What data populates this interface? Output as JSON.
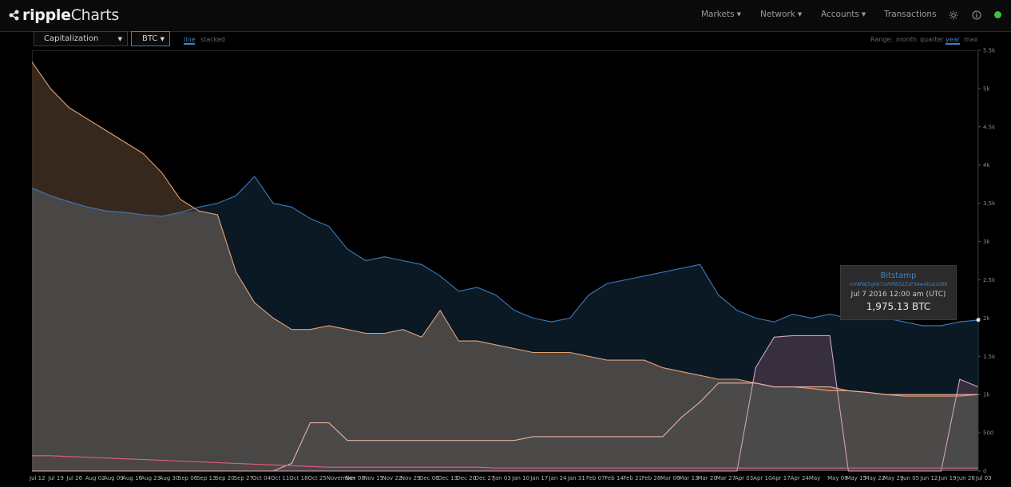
{
  "header": {
    "logo_word1": "ripple",
    "logo_word2": "Charts",
    "nav": [
      {
        "label": "Markets",
        "caret": true
      },
      {
        "label": "Network",
        "caret": true
      },
      {
        "label": "Accounts",
        "caret": true
      },
      {
        "label": "Transactions",
        "caret": false
      }
    ],
    "icons": [
      "settings-icon",
      "info-icon",
      "status-indicator"
    ],
    "status_color": "#3fbf3f"
  },
  "controls": {
    "metric": "Capitalization",
    "currency": "BTC",
    "modes": [
      "line",
      "stacked"
    ],
    "active_mode": "line",
    "range_label": "Range:",
    "ranges": [
      "month",
      "quarter",
      "year",
      "max"
    ],
    "active_range": "year"
  },
  "tooltip": {
    "name": "Bitstamp",
    "address": "rvYAfWj5gh67oV6fW32ZzP3Aw4Eubs59B",
    "date": "Jul 7 2016 12:00 am (UTC)",
    "value": "1,975.13 BTC"
  },
  "chart_data": {
    "type": "area",
    "title": "",
    "xlabel": "",
    "ylabel": "",
    "ylim": [
      0,
      5500
    ],
    "y_ticks": [
      "0",
      "500",
      "1k",
      "1.5k",
      "2k",
      "2.5k",
      "3k",
      "3.5k",
      "4k",
      "4.5k",
      "5k",
      "5.5k"
    ],
    "grid": false,
    "categories": [
      "Jul 12",
      "Jul 19",
      "Jul 26",
      "Aug 02",
      "Aug 09",
      "Aug 16",
      "Aug 23",
      "Aug 30",
      "Sep 06",
      "Sep 13",
      "Sep 20",
      "Sep 27",
      "Oct 04",
      "Oct 11",
      "Oct 18",
      "Oct 25",
      "November",
      "Nov 08",
      "Nov 15",
      "Nov 22",
      "Nov 29",
      "Dec 06",
      "Dec 13",
      "Dec 20",
      "Dec 27",
      "Jan 03",
      "Jan 10",
      "Jan 17",
      "Jan 24",
      "Jan 31",
      "Feb 07",
      "Feb 14",
      "Feb 21",
      "Feb 28",
      "Mar 06",
      "Mar 13",
      "Mar 20",
      "Mar 27",
      "Apr 03",
      "Apr 10",
      "Apr 17",
      "Apr 24",
      "May",
      "May 08",
      "May 15",
      "May 22",
      "May 29",
      "Jun 05",
      "Jun 12",
      "Jun 19",
      "Jun 26",
      "Jul 03"
    ],
    "series": [
      {
        "name": "Bitstamp",
        "color": "#3b7bbf",
        "fill": "#0c1a26",
        "values": [
          3700,
          3600,
          3520,
          3450,
          3400,
          3380,
          3350,
          3330,
          3380,
          3450,
          3500,
          3600,
          3850,
          3500,
          3450,
          3300,
          3200,
          2900,
          2750,
          2800,
          2750,
          2700,
          2550,
          2350,
          2400,
          2300,
          2100,
          2000,
          1950,
          2000,
          2300,
          2450,
          2500,
          2550,
          2600,
          2650,
          2700,
          2300,
          2100,
          2000,
          1950,
          2050,
          2000,
          2050,
          2000,
          2050,
          2000,
          1950,
          1900,
          1900,
          1950,
          1975
        ]
      },
      {
        "name": "",
        "color": "#e8a070",
        "fill": "#3a2a20",
        "values": [
          5350,
          5000,
          4750,
          4600,
          4450,
          4300,
          4150,
          3900,
          3550,
          3400,
          3350,
          2600,
          2200,
          2000,
          1850,
          1850,
          1900,
          1850,
          1800,
          1800,
          1850,
          1750,
          2100,
          1700,
          1700,
          1650,
          1600,
          1550,
          1550,
          1550,
          1500,
          1450,
          1450,
          1450,
          1350,
          1300,
          1250,
          1200,
          1200,
          1150,
          1100,
          1100,
          1080,
          1050,
          1050,
          1030,
          1000,
          980,
          980,
          980,
          980,
          1000
        ]
      },
      {
        "name": "",
        "color": "#d0a0c8",
        "fill": "#3a3040",
        "values": [
          0,
          0,
          0,
          0,
          0,
          0,
          0,
          0,
          0,
          0,
          0,
          0,
          0,
          0,
          0,
          0,
          0,
          0,
          0,
          0,
          0,
          0,
          0,
          0,
          0,
          0,
          0,
          0,
          0,
          0,
          0,
          0,
          0,
          0,
          0,
          0,
          0,
          0,
          0,
          1350,
          1750,
          1770,
          1770,
          1770,
          0,
          0,
          0,
          0,
          0,
          0,
          1200,
          1100
        ]
      },
      {
        "name": "",
        "color": "#e8b0a0",
        "fill": "#5a4a46",
        "values": [
          0,
          0,
          0,
          0,
          0,
          0,
          0,
          0,
          0,
          0,
          0,
          0,
          0,
          0,
          100,
          630,
          630,
          400,
          400,
          400,
          400,
          400,
          400,
          400,
          400,
          400,
          400,
          450,
          450,
          450,
          450,
          450,
          450,
          450,
          450,
          700,
          900,
          1150,
          1150,
          1150,
          1100,
          1100,
          1100,
          1100,
          1050,
          1030,
          1000,
          1000,
          1000,
          1000,
          1000,
          1000
        ]
      },
      {
        "name": "",
        "color": "#e06080",
        "fill": "#6a2030",
        "values": [
          200,
          200,
          190,
          180,
          170,
          160,
          150,
          140,
          130,
          120,
          110,
          100,
          90,
          80,
          70,
          60,
          50,
          50,
          50,
          50,
          50,
          50,
          50,
          50,
          50,
          40,
          40,
          40,
          40,
          40,
          40,
          40,
          40,
          40,
          40,
          40,
          40,
          40,
          40,
          40,
          40,
          40,
          40,
          40,
          40,
          40,
          40,
          40,
          40,
          40,
          40,
          40
        ]
      }
    ],
    "baseline_area": {
      "color": "#4a4a4a"
    }
  }
}
